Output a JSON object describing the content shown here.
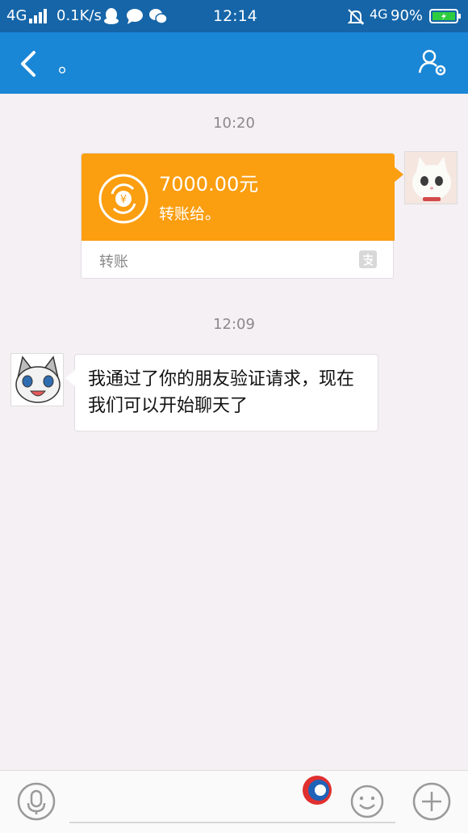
{
  "status_bar": {
    "network_left": "4G",
    "speed": "0.1K/s",
    "time": "12:14",
    "network_right": "4G",
    "battery": "90%"
  },
  "header": {
    "title": "。"
  },
  "messages": {
    "time_1": "10:20",
    "transfer": {
      "amount": "7000.00元",
      "to": "转账给。",
      "label": "转账"
    },
    "time_2": "12:09",
    "text": "我通过了你的朋友验证请求，现在我们可以开始聊天了"
  },
  "input_bar": {
    "placeholder": ""
  },
  "colors": {
    "header": "#1a86d6",
    "status_bar": "#1565a8",
    "transfer": "#fb9e0f",
    "background": "#f4f0f4"
  }
}
